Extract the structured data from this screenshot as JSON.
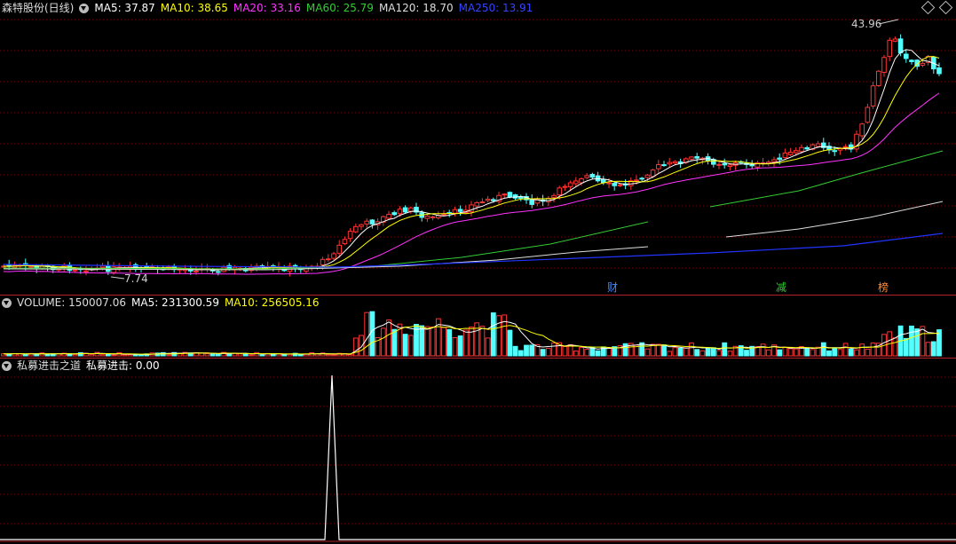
{
  "price_panel": {
    "stock_name": "森特股份(日线)",
    "ma": [
      {
        "label": "MA5: 37.87",
        "color": "#ffffff"
      },
      {
        "label": "MA10: 38.65",
        "color": "#ffff00"
      },
      {
        "label": "MA20: 33.16",
        "color": "#ff33ff"
      },
      {
        "label": "MA60: 25.79",
        "color": "#33cc33"
      },
      {
        "label": "MA120: 18.70",
        "color": "#dddddd"
      },
      {
        "label": "MA250: 13.91",
        "color": "#2233ff"
      }
    ],
    "high_label": "43.96",
    "low_label": "7.74",
    "markers": [
      {
        "text": "财",
        "color": "#4488ff"
      },
      {
        "text": "减",
        "color": "#33cc33"
      },
      {
        "text": "榜",
        "color": "#ff8833"
      }
    ]
  },
  "volume_panel": {
    "label": "VOLUME: 150007.06",
    "ma5": "MA5: 231300.59",
    "ma10": "MA10: 256505.16"
  },
  "indicator_panel": {
    "name": "私募进击之道",
    "value": "私募进击: 0.00"
  },
  "colors": {
    "up": "#ff3232",
    "down": "#54ffff",
    "grid": "#8b0000",
    "background": "#000000"
  },
  "chart_data": {
    "type": "candlestick",
    "series": [
      {
        "name": "MA5",
        "value": 37.87
      },
      {
        "name": "MA10",
        "value": 38.65
      },
      {
        "name": "MA20",
        "value": 33.16
      },
      {
        "name": "MA60",
        "value": 25.79
      },
      {
        "name": "MA120",
        "value": 18.7
      },
      {
        "name": "MA250",
        "value": 13.91
      }
    ],
    "period_high": 43.96,
    "period_low": 7.74,
    "volume": 150007.06,
    "volume_ma5": 231300.59,
    "volume_ma10": 256505.16,
    "indicator_value": 0.0
  }
}
